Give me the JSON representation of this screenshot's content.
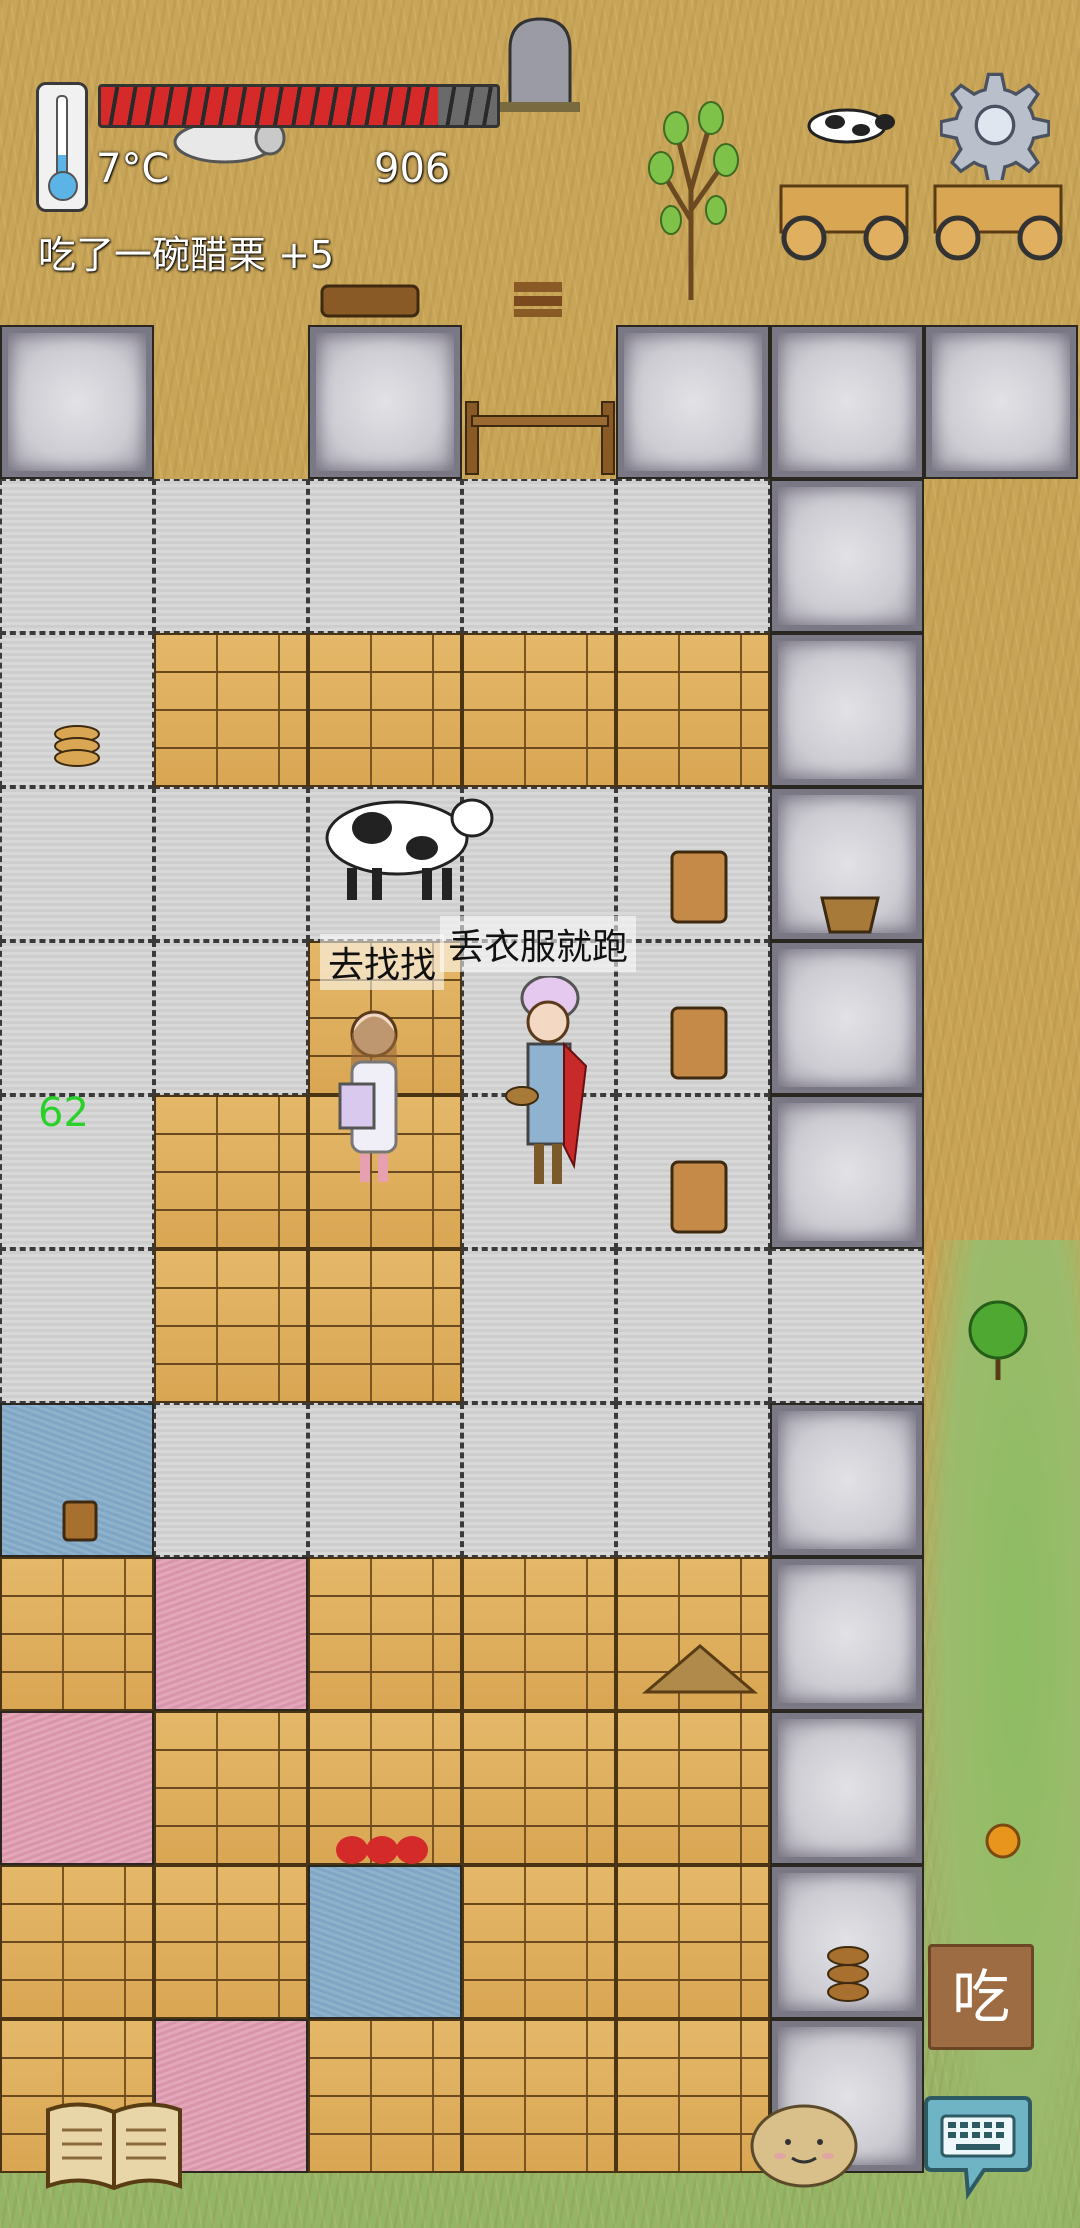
{
  "hud": {
    "temperature": "7°C",
    "score": "906",
    "last_meal": "吃了一碗醋栗 +5",
    "food_meter_fraction": 0.85
  },
  "speech": {
    "player_left": "去找找",
    "player_right": "丢衣服就跑"
  },
  "popups": {
    "yum_count": "62"
  },
  "controls": {
    "eat_label": "吃"
  },
  "icons": {
    "settings": "gear-icon",
    "recipe_book": "book-icon",
    "emote": "potato-face-icon",
    "chat": "keyboard-icon",
    "temperature": "thermometer-icon"
  },
  "colors": {
    "food_bar": "#d62a2a",
    "yum_text": "#2bd12b",
    "eat_button": "#9e6c43"
  }
}
